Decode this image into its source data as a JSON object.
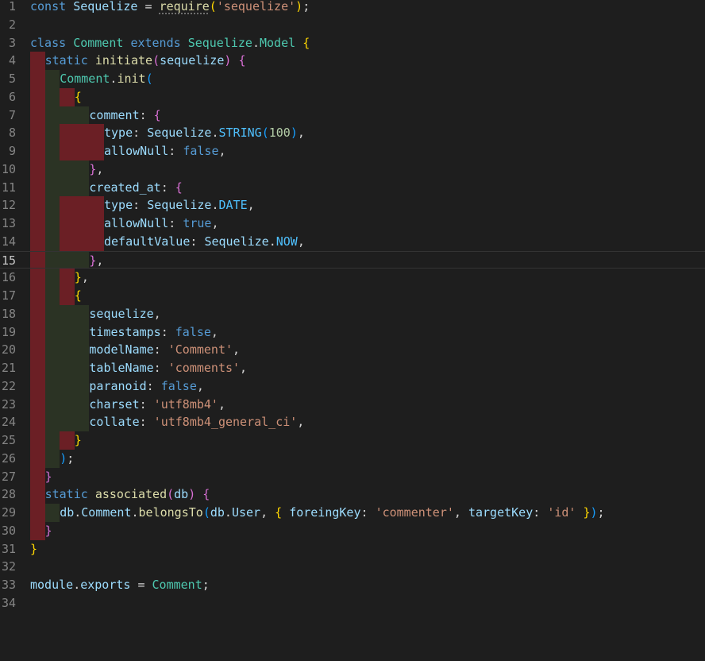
{
  "editor": {
    "colors": {
      "background": "#1e1e1e",
      "indent_guide_error": "#6b1f25",
      "indent_guide_even": "#2b3324",
      "line_number": "#858585"
    },
    "current_line": "15",
    "lines": [
      {
        "num": "1",
        "indent": 0,
        "tokens": [
          [
            "const",
            "kw"
          ],
          [
            " ",
            "p"
          ],
          [
            "Sequelize",
            "var"
          ],
          [
            " = ",
            "p"
          ],
          [
            "require",
            "fn",
            "squiggle"
          ],
          [
            "(",
            "b1"
          ],
          [
            "'sequelize'",
            "str"
          ],
          [
            ")",
            "b1"
          ],
          [
            ";",
            "p"
          ]
        ]
      },
      {
        "num": "2",
        "indent": 0,
        "tokens": []
      },
      {
        "num": "3",
        "indent": 0,
        "tokens": [
          [
            "class",
            "kw"
          ],
          [
            " ",
            "p"
          ],
          [
            "Comment",
            "cls"
          ],
          [
            " ",
            "p"
          ],
          [
            "extends",
            "kw"
          ],
          [
            " ",
            "p"
          ],
          [
            "Sequelize",
            "cls"
          ],
          [
            ".",
            "p"
          ],
          [
            "Model",
            "cls"
          ],
          [
            " ",
            "p"
          ],
          [
            "{",
            "b1"
          ]
        ]
      },
      {
        "num": "4",
        "indent": 1,
        "tokens": [
          [
            "static",
            "kw"
          ],
          [
            " ",
            "p"
          ],
          [
            "initiate",
            "fn"
          ],
          [
            "(",
            "b2"
          ],
          [
            "sequelize",
            "var"
          ],
          [
            ")",
            "b2"
          ],
          [
            " ",
            "p"
          ],
          [
            "{",
            "b2"
          ]
        ]
      },
      {
        "num": "5",
        "indent": 2,
        "tokens": [
          [
            "Comment",
            "cls"
          ],
          [
            ".",
            "p"
          ],
          [
            "init",
            "fn"
          ],
          [
            "(",
            "b3"
          ]
        ]
      },
      {
        "num": "6",
        "indent": 3,
        "tokens": [
          [
            "{",
            "b1"
          ]
        ]
      },
      {
        "num": "7",
        "indent": 4,
        "tokens": [
          [
            "comment",
            "prop"
          ],
          [
            ": ",
            "p"
          ],
          [
            "{",
            "b2"
          ]
        ]
      },
      {
        "num": "8",
        "indent": 5,
        "tokens": [
          [
            "type",
            "prop"
          ],
          [
            ": ",
            "p"
          ],
          [
            "Sequelize",
            "var"
          ],
          [
            ".",
            "p"
          ],
          [
            "STRING",
            "const"
          ],
          [
            "(",
            "b3"
          ],
          [
            "100",
            "num"
          ],
          [
            ")",
            "b3"
          ],
          [
            ",",
            "p"
          ]
        ]
      },
      {
        "num": "9",
        "indent": 5,
        "tokens": [
          [
            "allowNull",
            "prop"
          ],
          [
            ": ",
            "p"
          ],
          [
            "false",
            "kw"
          ],
          [
            ",",
            "p"
          ]
        ]
      },
      {
        "num": "10",
        "indent": 4,
        "tokens": [
          [
            "}",
            "b2"
          ],
          [
            ",",
            "p"
          ]
        ]
      },
      {
        "num": "11",
        "indent": 4,
        "tokens": [
          [
            "created_at",
            "prop"
          ],
          [
            ": ",
            "p"
          ],
          [
            "{",
            "b2"
          ]
        ]
      },
      {
        "num": "12",
        "indent": 5,
        "tokens": [
          [
            "type",
            "prop"
          ],
          [
            ": ",
            "p"
          ],
          [
            "Sequelize",
            "var"
          ],
          [
            ".",
            "p"
          ],
          [
            "DATE",
            "const"
          ],
          [
            ",",
            "p"
          ]
        ]
      },
      {
        "num": "13",
        "indent": 5,
        "tokens": [
          [
            "allowNull",
            "prop"
          ],
          [
            ": ",
            "p"
          ],
          [
            "true",
            "kw"
          ],
          [
            ",",
            "p"
          ]
        ]
      },
      {
        "num": "14",
        "indent": 5,
        "tokens": [
          [
            "defaultValue",
            "prop"
          ],
          [
            ": ",
            "p"
          ],
          [
            "Sequelize",
            "var"
          ],
          [
            ".",
            "p"
          ],
          [
            "NOW",
            "const"
          ],
          [
            ",",
            "p"
          ]
        ]
      },
      {
        "num": "15",
        "indent": 4,
        "tokens": [
          [
            "}",
            "b2"
          ],
          [
            ",",
            "p"
          ]
        ]
      },
      {
        "num": "16",
        "indent": 3,
        "tokens": [
          [
            "}",
            "b1"
          ],
          [
            ",",
            "p"
          ]
        ]
      },
      {
        "num": "17",
        "indent": 3,
        "tokens": [
          [
            "{",
            "b1"
          ]
        ]
      },
      {
        "num": "18",
        "indent": 4,
        "tokens": [
          [
            "sequelize",
            "var"
          ],
          [
            ",",
            "p"
          ]
        ]
      },
      {
        "num": "19",
        "indent": 4,
        "tokens": [
          [
            "timestamps",
            "prop"
          ],
          [
            ": ",
            "p"
          ],
          [
            "false",
            "kw"
          ],
          [
            ",",
            "p"
          ]
        ]
      },
      {
        "num": "20",
        "indent": 4,
        "tokens": [
          [
            "modelName",
            "prop"
          ],
          [
            ": ",
            "p"
          ],
          [
            "'Comment'",
            "str"
          ],
          [
            ",",
            "p"
          ]
        ]
      },
      {
        "num": "21",
        "indent": 4,
        "tokens": [
          [
            "tableName",
            "prop"
          ],
          [
            ": ",
            "p"
          ],
          [
            "'comments'",
            "str"
          ],
          [
            ",",
            "p"
          ]
        ]
      },
      {
        "num": "22",
        "indent": 4,
        "tokens": [
          [
            "paranoid",
            "prop"
          ],
          [
            ": ",
            "p"
          ],
          [
            "false",
            "kw"
          ],
          [
            ",",
            "p"
          ]
        ]
      },
      {
        "num": "23",
        "indent": 4,
        "tokens": [
          [
            "charset",
            "prop"
          ],
          [
            ": ",
            "p"
          ],
          [
            "'utf8mb4'",
            "str"
          ],
          [
            ",",
            "p"
          ]
        ]
      },
      {
        "num": "24",
        "indent": 4,
        "tokens": [
          [
            "collate",
            "prop"
          ],
          [
            ": ",
            "p"
          ],
          [
            "'utf8mb4_general_ci'",
            "str"
          ],
          [
            ",",
            "p"
          ]
        ]
      },
      {
        "num": "25",
        "indent": 3,
        "tokens": [
          [
            "}",
            "b1"
          ]
        ]
      },
      {
        "num": "26",
        "indent": 2,
        "tokens": [
          [
            ")",
            "b3"
          ],
          [
            ";",
            "p"
          ]
        ]
      },
      {
        "num": "27",
        "indent": 1,
        "tokens": [
          [
            "}",
            "b2"
          ]
        ]
      },
      {
        "num": "28",
        "indent": 1,
        "tokens": [
          [
            "static",
            "kw"
          ],
          [
            " ",
            "p"
          ],
          [
            "associated",
            "fn"
          ],
          [
            "(",
            "b2"
          ],
          [
            "db",
            "var"
          ],
          [
            ")",
            "b2"
          ],
          [
            " ",
            "p"
          ],
          [
            "{",
            "b2"
          ]
        ]
      },
      {
        "num": "29",
        "indent": 2,
        "tokens": [
          [
            "db",
            "var"
          ],
          [
            ".",
            "p"
          ],
          [
            "Comment",
            "var"
          ],
          [
            ".",
            "p"
          ],
          [
            "belongsTo",
            "fn"
          ],
          [
            "(",
            "b3"
          ],
          [
            "db",
            "var"
          ],
          [
            ".",
            "p"
          ],
          [
            "User",
            "var"
          ],
          [
            ", ",
            "p"
          ],
          [
            "{",
            "b1"
          ],
          [
            " ",
            "p"
          ],
          [
            "foreingKey",
            "prop"
          ],
          [
            ": ",
            "p"
          ],
          [
            "'commenter'",
            "str"
          ],
          [
            ", ",
            "p"
          ],
          [
            "targetKey",
            "prop"
          ],
          [
            ": ",
            "p"
          ],
          [
            "'id'",
            "str"
          ],
          [
            " ",
            "p"
          ],
          [
            "}",
            "b1"
          ],
          [
            ")",
            "b3"
          ],
          [
            ";",
            "p"
          ]
        ]
      },
      {
        "num": "30",
        "indent": 1,
        "tokens": [
          [
            "}",
            "b2"
          ]
        ]
      },
      {
        "num": "31",
        "indent": 0,
        "tokens": [
          [
            "}",
            "b1"
          ]
        ]
      },
      {
        "num": "32",
        "indent": 0,
        "tokens": []
      },
      {
        "num": "33",
        "indent": 0,
        "tokens": [
          [
            "module",
            "var"
          ],
          [
            ".",
            "p"
          ],
          [
            "exports",
            "var"
          ],
          [
            " = ",
            "p"
          ],
          [
            "Comment",
            "cls"
          ],
          [
            ";",
            "p"
          ]
        ]
      },
      {
        "num": "34",
        "indent": 0,
        "tokens": []
      }
    ]
  }
}
